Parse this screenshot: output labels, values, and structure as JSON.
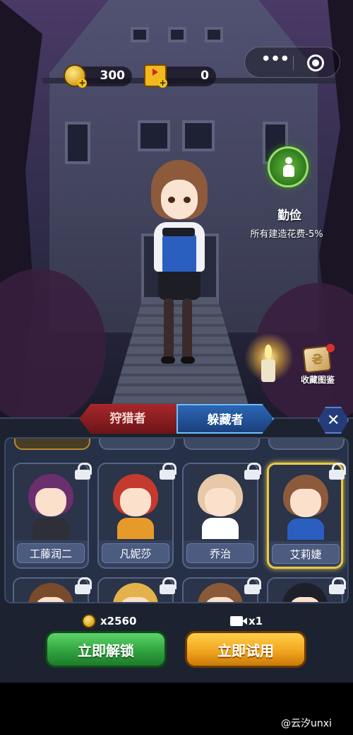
{
  "resources": {
    "coins": "300",
    "videos": "0"
  },
  "capsule": {
    "more_icon": "more-dots-icon",
    "close_icon": "target-icon"
  },
  "skill": {
    "icon": "frugal-figure-icon",
    "name": "勤俭",
    "description": "所有建造花费-5%"
  },
  "collection": {
    "label": "收藏图鉴"
  },
  "tabs": [
    {
      "label": "狩猎者",
      "active": false
    },
    {
      "label": "躲藏者",
      "active": true
    }
  ],
  "characters": [
    {
      "name": "工藤润二",
      "locked": true,
      "selected": false,
      "hair": "#6b2f6e",
      "outfit": "#2f2f38"
    },
    {
      "name": "凡妮莎",
      "locked": true,
      "selected": false,
      "hair": "#c43a2e",
      "outfit": "#e69a2a"
    },
    {
      "name": "乔治",
      "locked": true,
      "selected": false,
      "hair": "#e7c9a9",
      "outfit": "#ffffff"
    },
    {
      "name": "艾莉婕",
      "locked": true,
      "selected": true,
      "hair": "#8d5a3b",
      "outfit": "#2a5fbf"
    }
  ],
  "characters_row2": [
    {
      "locked": true,
      "hair": "#7a4a2c"
    },
    {
      "locked": true,
      "hair": "#e3b24a"
    },
    {
      "locked": true,
      "hair": "#8a5a38"
    },
    {
      "locked": true,
      "hair": "#1f1f2a"
    }
  ],
  "price": {
    "coin": "x2560",
    "video": "x1"
  },
  "buttons": {
    "unlock": "立即解锁",
    "try": "立即试用"
  },
  "watermark": "@云汐unxi",
  "colors": {
    "unlock_button": "#2fa33e",
    "try_button": "#f2a51f",
    "hider_tab": "#2b67b5",
    "hunter_tab": "#a7282b",
    "selected_card": "#e8c84a"
  }
}
